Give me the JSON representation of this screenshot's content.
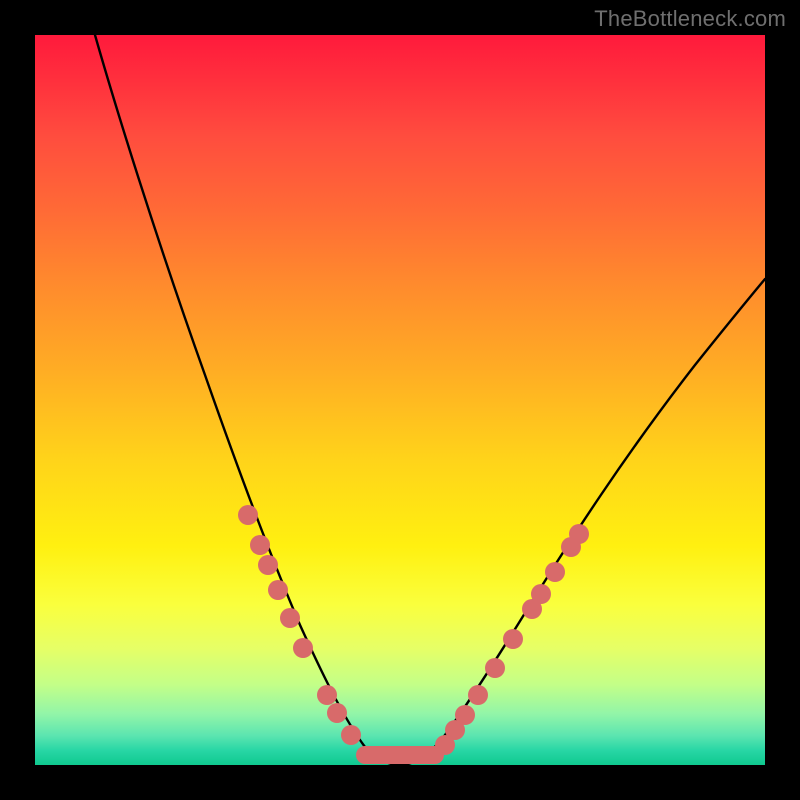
{
  "watermark": "TheBottleneck.com",
  "colors": {
    "background": "#000000",
    "gradient_top": "#ff1a3c",
    "gradient_bottom": "#0fc98f",
    "curve": "#000000",
    "markers": "#d86a6a"
  },
  "chart_data": {
    "type": "line",
    "title": "",
    "xlabel": "",
    "ylabel": "",
    "xlim": [
      0,
      100
    ],
    "ylim": [
      0,
      100
    ],
    "grid": false,
    "legend": false,
    "note": "V-shaped bottleneck curve over a red→green vertical gradient; values are approximate pixel-normalized estimates (0–100) read from the figure",
    "series": [
      {
        "name": "bottleneck-curve",
        "x": [
          3,
          6,
          10,
          14,
          18,
          22,
          26,
          30,
          34,
          37,
          40,
          42,
          44,
          46,
          48,
          50,
          53,
          56,
          60,
          65,
          71,
          78,
          86,
          95,
          100
        ],
        "y": [
          100,
          90,
          78,
          67,
          57,
          48,
          40,
          33,
          26,
          20,
          14,
          10,
          6,
          3,
          1,
          0,
          1,
          3,
          7,
          13,
          21,
          31,
          42,
          54,
          61
        ]
      }
    ],
    "markers": [
      {
        "x": 30,
        "y": 33
      },
      {
        "x": 32,
        "y": 29
      },
      {
        "x": 34,
        "y": 25
      },
      {
        "x": 36,
        "y": 21
      },
      {
        "x": 38,
        "y": 17
      },
      {
        "x": 40,
        "y": 13
      },
      {
        "x": 42,
        "y": 9
      },
      {
        "x": 44,
        "y": 5
      },
      {
        "x": 46,
        "y": 2
      },
      {
        "x": 48,
        "y": 1
      },
      {
        "x": 50,
        "y": 0
      },
      {
        "x": 52,
        "y": 1
      },
      {
        "x": 54,
        "y": 2
      },
      {
        "x": 56,
        "y": 5
      },
      {
        "x": 58,
        "y": 9
      },
      {
        "x": 60,
        "y": 13
      },
      {
        "x": 62,
        "y": 17
      },
      {
        "x": 64,
        "y": 21
      },
      {
        "x": 66,
        "y": 25
      },
      {
        "x": 68,
        "y": 30
      }
    ]
  }
}
